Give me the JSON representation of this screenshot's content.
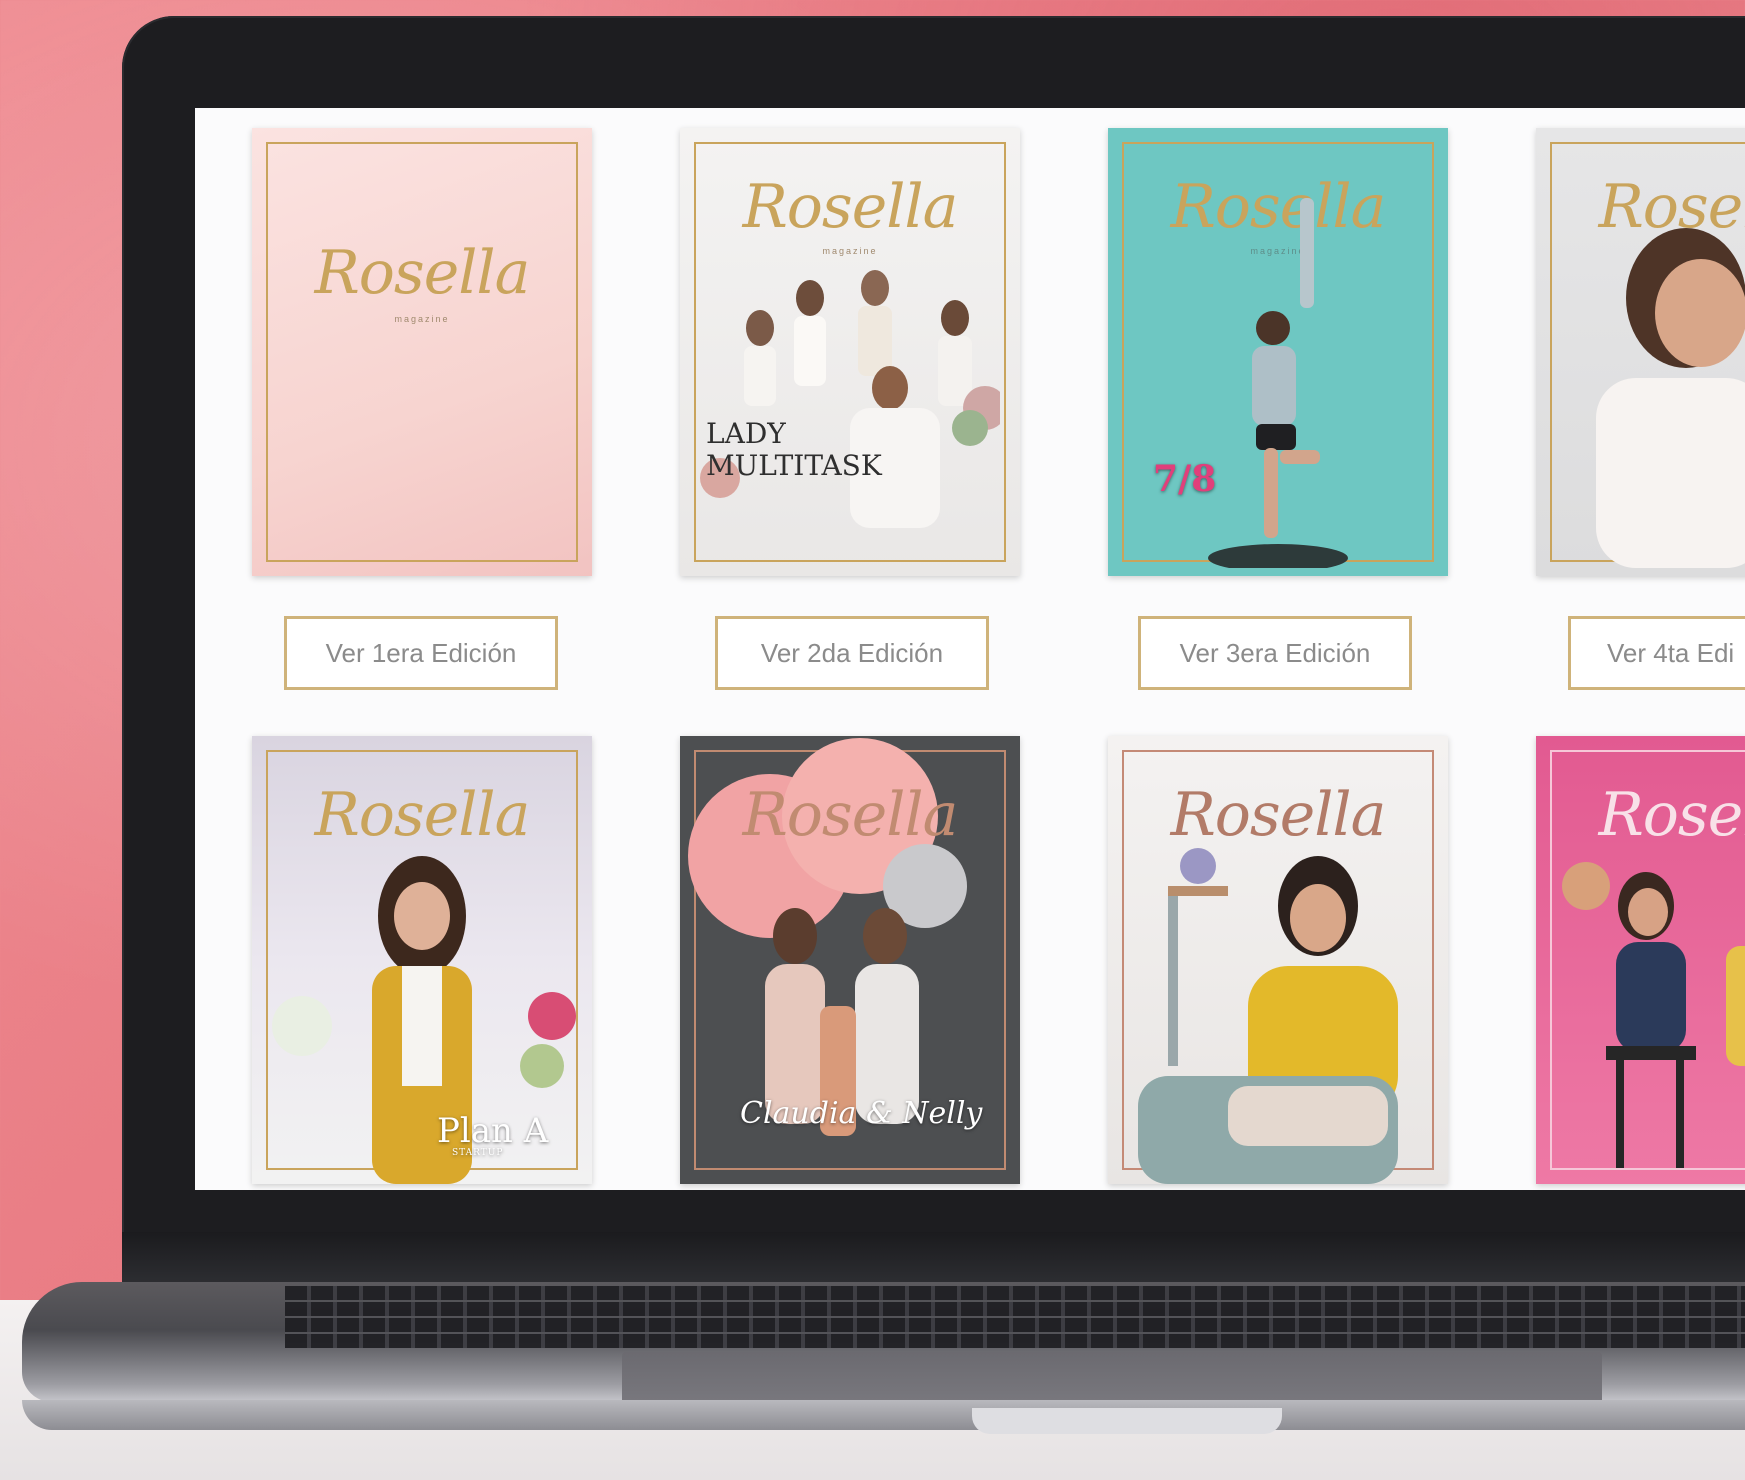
{
  "brand": "Rosella",
  "tagline": "magazine",
  "editions": [
    {
      "button": "Ver 1era Edición"
    },
    {
      "button": "Ver 2da Edición",
      "cover_text": "LADY MULTITASK"
    },
    {
      "button": "Ver 3era Edición",
      "cover_text": "7/8"
    },
    {
      "button": "Ver 4ta Edi"
    }
  ],
  "covers_row2": [
    {
      "cover_text": "Plan A",
      "cover_small": "STARTUP"
    },
    {
      "cover_text": "Claudia & Nelly"
    },
    {
      "cover_text": ""
    },
    {
      "cover_text": ""
    }
  ],
  "colors": {
    "gold": "#c9a45c",
    "wall": "#ef8d93"
  }
}
